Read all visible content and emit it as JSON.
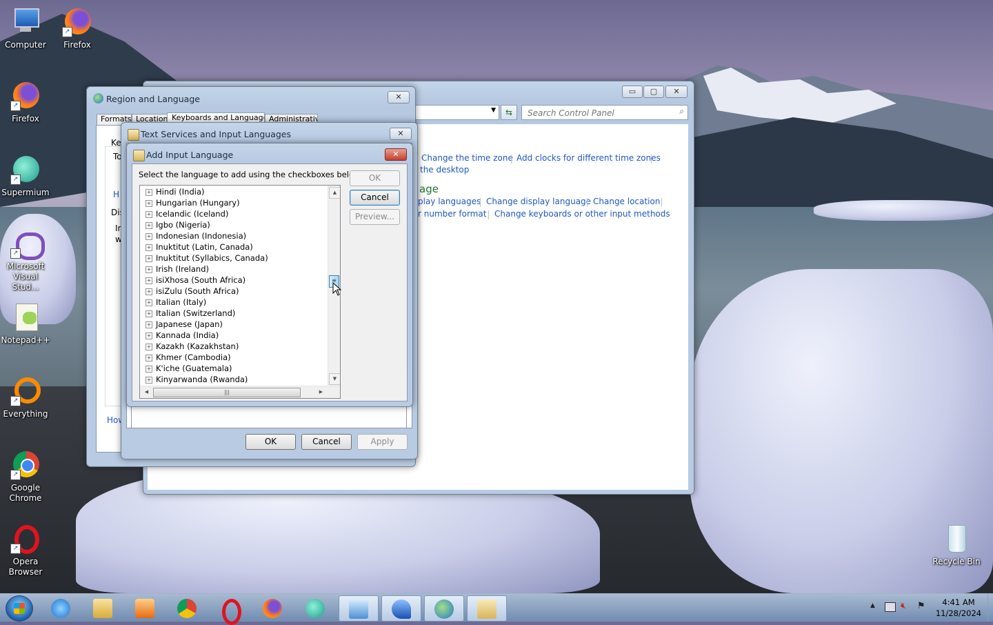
{
  "desktop_icons": [
    {
      "name": "computer",
      "label": "Computer"
    },
    {
      "name": "firefox",
      "label": "Firefox"
    },
    {
      "name": "firefox2",
      "label": "Firefox"
    },
    {
      "name": "supermium",
      "label": "Supermium"
    },
    {
      "name": "vs",
      "label": "Microsoft Visual Stud..."
    },
    {
      "name": "notepad",
      "label": "Notepad++"
    },
    {
      "name": "everything",
      "label": "Everything"
    },
    {
      "name": "chrome",
      "label": "Google Chrome"
    },
    {
      "name": "opera",
      "label": "Opera Browser"
    },
    {
      "name": "recycle",
      "label": "Recycle Bin"
    }
  ],
  "control_panel": {
    "search_placeholder": "Search Control Panel",
    "links_row1": [
      "Change the time zone",
      "Add clocks for different time zones"
    ],
    "link_desktop": "the desktop",
    "section_heading": "age",
    "links_row2": [
      "play languages",
      "Change display language",
      "Change location"
    ],
    "links_row3": [
      "r number format",
      "Change keyboards or other input methods"
    ]
  },
  "region_dialog": {
    "title": "Region and Language",
    "tabs": [
      "Formats",
      "Location",
      "Keyboards and Languages",
      "Administrative"
    ],
    "frag_ke": "Ke",
    "frag_to": "To",
    "frag_h": "H",
    "frag_dis": "Dis",
    "frag_i": "Ir",
    "frag_w": "w",
    "frag_how": "How"
  },
  "text_services": {
    "title": "Text Services and Input Languages",
    "ok": "OK",
    "cancel": "Cancel",
    "apply": "Apply"
  },
  "add_input": {
    "title": "Add Input Language",
    "instruction": "Select the language to add using the checkboxes below.",
    "ok": "OK",
    "cancel": "Cancel",
    "preview": "Preview...",
    "languages": [
      "Hindi (India)",
      "Hungarian (Hungary)",
      "Icelandic (Iceland)",
      "Igbo (Nigeria)",
      "Indonesian (Indonesia)",
      "Inuktitut (Latin, Canada)",
      "Inuktitut (Syllabics, Canada)",
      "Irish (Ireland)",
      "isiXhosa (South Africa)",
      "isiZulu (South Africa)",
      "Italian (Italy)",
      "Italian (Switzerland)",
      "Japanese (Japan)",
      "Kannada (India)",
      "Kazakh (Kazakhstan)",
      "Khmer (Cambodia)",
      "K'iche (Guatemala)",
      "Kinyarwanda (Rwanda)"
    ]
  },
  "tray": {
    "time": "4:41 AM",
    "date": "11/28/2024"
  }
}
